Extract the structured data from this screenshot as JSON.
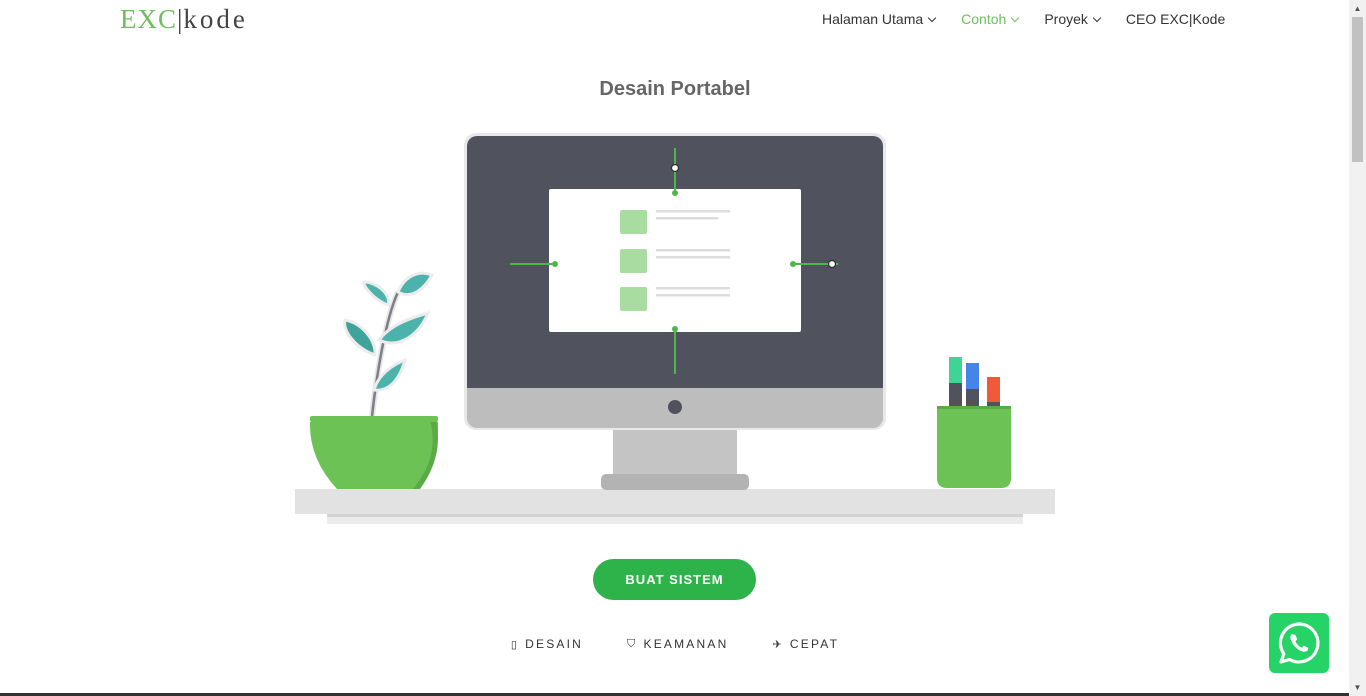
{
  "brand": {
    "part1": "EXC",
    "separator": "|",
    "part2": "kode"
  },
  "nav": {
    "items": [
      {
        "label": "Halaman Utama",
        "dropdown": true
      },
      {
        "label": "Contoh",
        "dropdown": true,
        "active": true
      },
      {
        "label": "Proyek",
        "dropdown": true
      },
      {
        "label": "CEO EXC|Kode",
        "dropdown": false
      }
    ]
  },
  "hero": {
    "title": "Desain Portabel",
    "cta_label": "BUAT SISTEM"
  },
  "features": [
    {
      "icon": "mobile-icon",
      "glyph": "▯",
      "label": "DESAIN"
    },
    {
      "icon": "shield-icon",
      "glyph": "⛉",
      "label": "KEAMANAN"
    },
    {
      "icon": "plane-icon",
      "glyph": "✈",
      "label": "CEPAT"
    }
  ],
  "colors": {
    "accent": "#6cbf5a",
    "button": "#2db34a",
    "whatsapp": "#25d366",
    "monitor": "#50525e"
  }
}
